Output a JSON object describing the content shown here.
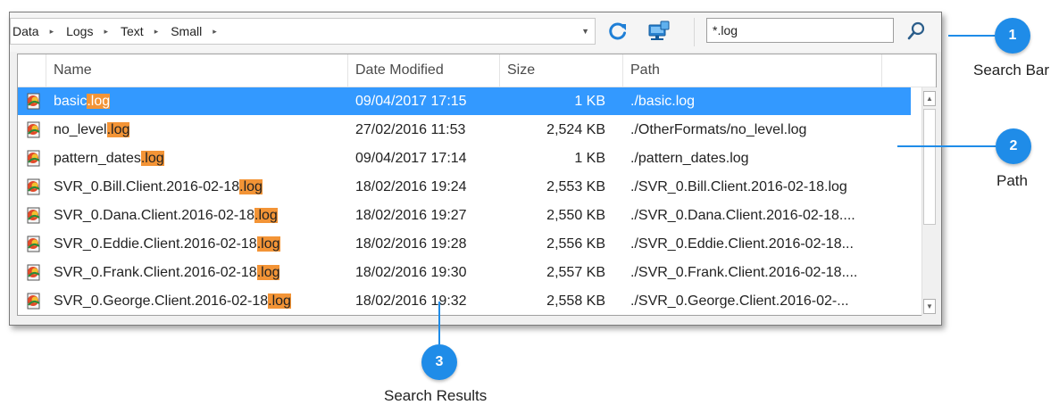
{
  "breadcrumb": [
    "Data",
    "Logs",
    "Text",
    "Small"
  ],
  "search": {
    "value": "*.log"
  },
  "columns": {
    "name": "Name",
    "date": "Date Modified",
    "size": "Size",
    "path": "Path"
  },
  "files": [
    {
      "name": "basic",
      "ext": ".log",
      "date": "09/04/2017 17:15",
      "size": "1 KB",
      "path": "./basic.log",
      "selected": true
    },
    {
      "name": "no_level",
      "ext": ".log",
      "date": "27/02/2016 11:53",
      "size": "2,524 KB",
      "path": "./OtherFormats/no_level.log"
    },
    {
      "name": "pattern_dates",
      "ext": ".log",
      "date": "09/04/2017 17:14",
      "size": "1 KB",
      "path": "./pattern_dates.log"
    },
    {
      "name": "SVR_0.Bill.Client.2016-02-18",
      "ext": ".log",
      "date": "18/02/2016 19:24",
      "size": "2,553 KB",
      "path": "./SVR_0.Bill.Client.2016-02-18.log"
    },
    {
      "name": "SVR_0.Dana.Client.2016-02-18",
      "ext": ".log",
      "date": "18/02/2016 19:27",
      "size": "2,550 KB",
      "path": "./SVR_0.Dana.Client.2016-02-18...."
    },
    {
      "name": "SVR_0.Eddie.Client.2016-02-18",
      "ext": ".log",
      "date": "18/02/2016 19:28",
      "size": "2,556 KB",
      "path": "./SVR_0.Eddie.Client.2016-02-18..."
    },
    {
      "name": "SVR_0.Frank.Client.2016-02-18",
      "ext": ".log",
      "date": "18/02/2016 19:30",
      "size": "2,557 KB",
      "path": "./SVR_0.Frank.Client.2016-02-18...."
    },
    {
      "name": "SVR_0.George.Client.2016-02-18",
      "ext": ".log",
      "date": "18/02/2016 19:32",
      "size": "2,558 KB",
      "path": "./SVR_0.George.Client.2016-02-..."
    }
  ],
  "callouts": [
    {
      "number": "1",
      "label": "Search Bar"
    },
    {
      "number": "2",
      "label": "Path"
    },
    {
      "number": "3",
      "label": "Search Results"
    }
  ],
  "colors": {
    "selection": "#3399ff",
    "highlight": "#f39436",
    "callout": "#1f8ce8"
  },
  "icons": {
    "refresh": "refresh-icon",
    "network": "network-drive-icon",
    "search": "search-icon",
    "file": "log-file-icon"
  }
}
